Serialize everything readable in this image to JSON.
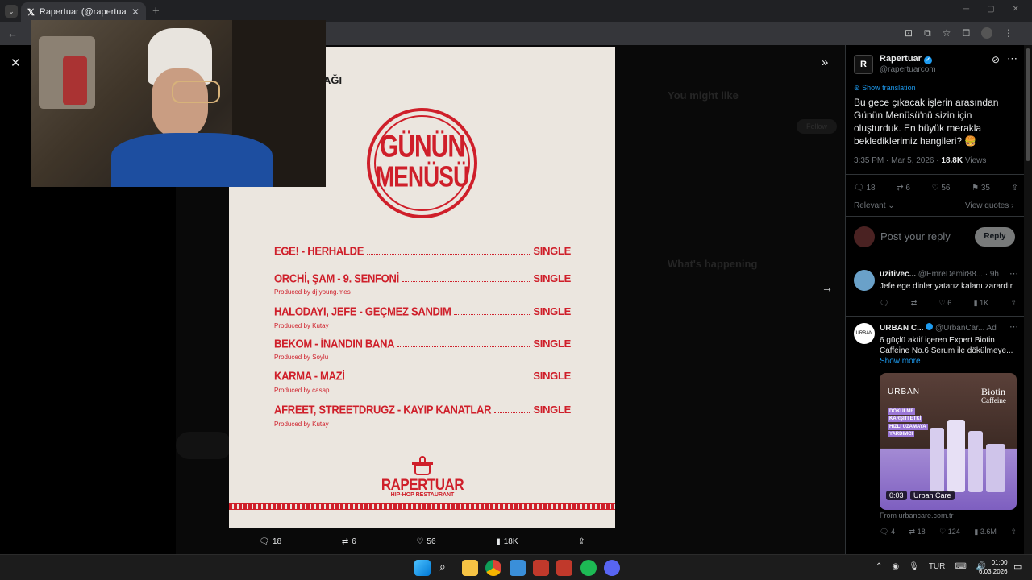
{
  "browser": {
    "tab_title": "Rapertuar (@rapertuarcom) / X",
    "new_tab": "+"
  },
  "poster": {
    "heading_fragment": "AĞI",
    "stamp_line1": "GÜNÜN",
    "stamp_line2": "MENÜSÜ",
    "rows": [
      {
        "title": "EGE! - HERHALDE",
        "type": "SINGLE",
        "producer": ""
      },
      {
        "title": "ORCHİ, ŞAM - 9. SENFONİ",
        "type": "SINGLE",
        "producer": "Produced by dj.young.mes"
      },
      {
        "title": "HALODAYI, JEFE - GEÇMEZ SANDIM",
        "type": "SINGLE",
        "producer": "Produced by Kutay"
      },
      {
        "title": "BEKOM - İNANDIN BANA",
        "type": "SINGLE",
        "producer": "Produced by Soylu"
      },
      {
        "title": "KARMA - MAZİ",
        "type": "SINGLE",
        "producer": "Produced by casap"
      },
      {
        "title": "AFREET, STREETDRUGZ - KAYIP KANATLAR",
        "type": "SINGLE",
        "producer": "Produced by Kutay"
      }
    ],
    "brand": "RAPERTUAR",
    "brand_sub": "HIP-HOP RESTAURANT"
  },
  "media_stats": {
    "replies": "18",
    "reposts": "6",
    "likes": "56",
    "views": "18K"
  },
  "background_sidebar": {
    "you_might_like": "You might like",
    "whats_happening": "What's happening",
    "follow": "Follow"
  },
  "tweet": {
    "author_name": "Rapertuar",
    "author_handle": "@rapertuarcom",
    "show_translation": "Show translation",
    "text": "Bu gece çıkacak işlerin arasından Günün Menüsü'nü sizin için oluşturduk. En büyük merakla beklediklerimiz hangileri? 🍔",
    "time": "3:35 PM · Mar 5, 2026 · ",
    "views_count": "18.8K",
    "views_label": " Views",
    "replies": "18",
    "reposts": "6",
    "likes": "56",
    "bookmarks": "35",
    "sort": "Relevant",
    "view_quotes": "View quotes",
    "reply_placeholder": "Post your reply",
    "reply_button": "Reply"
  },
  "reply1": {
    "name": "uzitivec...",
    "handle": "@EmreDemir88...",
    "time": "· 9h",
    "text": "Jefe ege dinler yatarız kalanı zarardır",
    "likes": "6",
    "views": "1K"
  },
  "ad": {
    "name": "URBAN C...",
    "handle": "@UrbanCar...",
    "ad_label": "Ad",
    "text": "6 güçlü aktif içeren Expert Biotin Caffeine No.6 Serum ile dökülmeye...",
    "show_more": "Show more",
    "img_brand": "URBAN",
    "img_product_line1": "Biotin",
    "img_product_line2": "Caffeine",
    "img_tag1": "DÖKÜLME",
    "img_tag2": "KARŞITI ETKİ",
    "img_tag3": "HIZLI UZAMAYA",
    "img_tag4": "YARDIMCI",
    "video_time": "0:03",
    "video_source": "Urban Care",
    "from": "From urbancare.com.tr",
    "replies": "4",
    "reposts": "18",
    "likes": "124",
    "views": "3.6M",
    "avatar_text": "URBAN"
  },
  "taskbar": {
    "lang": "TUR",
    "time": "01:00",
    "date": "6.03.2026"
  }
}
